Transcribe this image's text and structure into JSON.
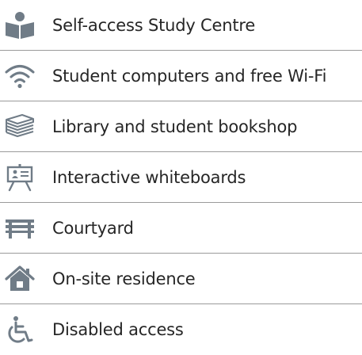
{
  "facilities": [
    {
      "label": "Self-access Study Centre",
      "icon": "reading-book-icon"
    },
    {
      "label": "Student computers and free Wi-Fi",
      "icon": "wifi-icon"
    },
    {
      "label": "Library and student bookshop",
      "icon": "books-stack-icon"
    },
    {
      "label": "Interactive whiteboards",
      "icon": "whiteboard-icon"
    },
    {
      "label": "Courtyard",
      "icon": "bench-icon"
    },
    {
      "label": "On-site residence",
      "icon": "house-icon"
    },
    {
      "label": "Disabled access",
      "icon": "wheelchair-icon"
    }
  ],
  "colors": {
    "icon": "#707c87",
    "text": "#262626",
    "divider": "#9a9a9a"
  }
}
